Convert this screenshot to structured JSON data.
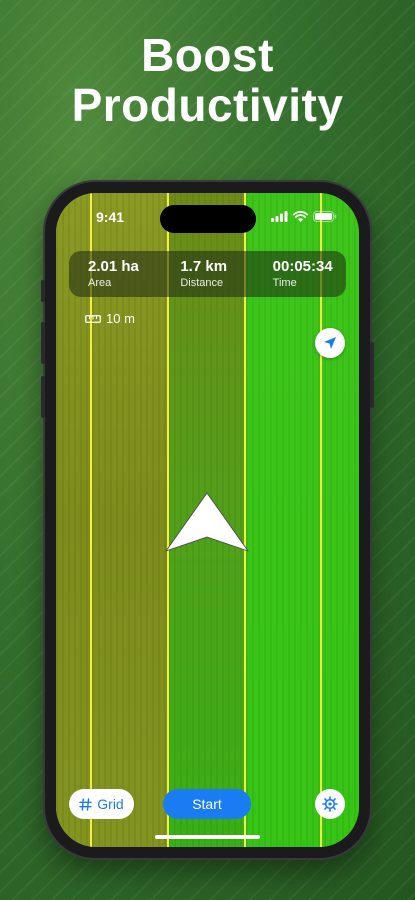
{
  "headline": {
    "line1": "Boost",
    "line2": "Productivity"
  },
  "status_bar": {
    "time": "9:41"
  },
  "stats": [
    {
      "value": "2.01 ha",
      "label": "Area"
    },
    {
      "value": "1.7 km",
      "label": "Distance"
    },
    {
      "value": "00:05:34",
      "label": "Time"
    }
  ],
  "scale": {
    "label": "10 m"
  },
  "controls": {
    "grid_label": "Grid",
    "start_label": "Start"
  },
  "colors": {
    "accent": "#1a7cf3",
    "track_line": "#f4ef3c",
    "worked_field": "#3ec51a",
    "unworked_field": "#8a9a23"
  },
  "icons": {
    "locate": "location-arrow-icon",
    "grid": "hash-grid-icon",
    "settings": "gear-icon",
    "scale": "ruler-icon",
    "heading": "navigation-arrow-icon"
  }
}
